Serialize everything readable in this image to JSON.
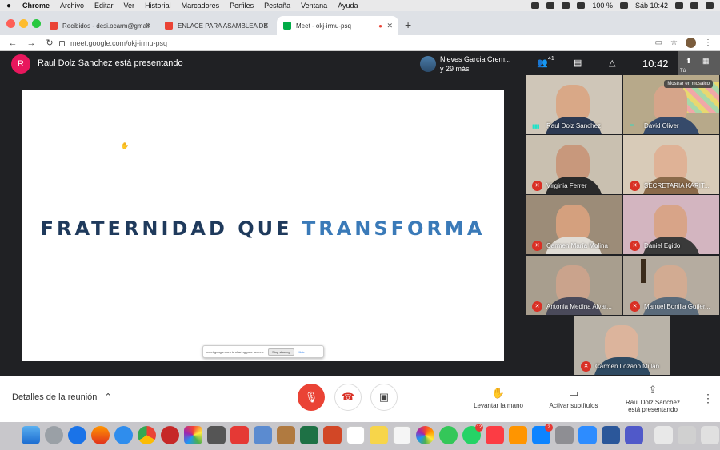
{
  "menubar": {
    "app": "Chrome",
    "items": [
      "Archivo",
      "Editar",
      "Ver",
      "Historial",
      "Marcadores",
      "Perfiles",
      "Pestaña",
      "Ventana",
      "Ayuda"
    ],
    "battery": "100 %",
    "datetime": "Sáb 10:42"
  },
  "tabs": [
    {
      "title": "Recibidos - desi.ocarm@gmail",
      "favicon_color": "#ea4335"
    },
    {
      "title": "ENLACE PARA ASAMBLEA DE",
      "favicon_color": "#ea4335"
    },
    {
      "title": "Meet - okj-irmu-psq",
      "favicon_color": "#00ac47"
    }
  ],
  "address": {
    "url": "meet.google.com/okj-irmu-psq"
  },
  "meet": {
    "presenter_initial": "R",
    "presenting_title": "Raul Dolz Sanchez está presentando",
    "viewer_name": "Nieves Garcia Crem...",
    "viewer_more": "y 29 más",
    "participant_count": "41",
    "clock": "10:42",
    "self_label": "Tú"
  },
  "slide": {
    "title_dark": "FRATERNIDAD QUE ",
    "title_light": "TRANSFORMA",
    "share_bar_text": "meet.google.com is sharing your screen.",
    "stop_sharing": "Stop sharing",
    "hide": "Hide"
  },
  "participants": [
    {
      "name": "Raul Dolz Sanchez",
      "muted": false,
      "bg": "#cfc6b8",
      "skin": "#d9a887",
      "shirt": "#2d3a52"
    },
    {
      "name": "David Oliver",
      "muted": false,
      "bg": "#b7a98a",
      "skin": "#d6a58a",
      "shirt": "#364a6a",
      "mosaic": "Mostrar en mosaico"
    },
    {
      "name": "Virginia Ferrer",
      "muted": true,
      "bg": "#c9c0b0",
      "skin": "#c8987c",
      "shirt": "#2a2a2a"
    },
    {
      "name": "SECRETARIA KARIT...",
      "muted": true,
      "bg": "#d8cbb8",
      "skin": "#dfb296",
      "shirt": "#8a6a4a"
    },
    {
      "name": "Carmen María Molina",
      "muted": true,
      "bg": "#9c8c78",
      "skin": "#d4a07e",
      "shirt": "#e0dcd5"
    },
    {
      "name": "Daniel Egido",
      "muted": true,
      "bg": "#d3b5c0",
      "skin": "#d8a488",
      "shirt": "#3a3a3a"
    },
    {
      "name": "Antonia Medina Alvar...",
      "muted": true,
      "bg": "#a89e8e",
      "skin": "#caa38c",
      "shirt": "#4a4a5a"
    },
    {
      "name": "Manuel Bonilla Gutier...",
      "muted": true,
      "bg": "#b5aca0",
      "skin": "#d2ab92",
      "shirt": "#5a6a7a"
    },
    {
      "name": "Carmen Lozano Millán",
      "muted": true,
      "bg": "#b9b3a8",
      "skin": "#dcb49c",
      "shirt": "#2f4a62"
    }
  ],
  "bottom": {
    "details": "Detalles de la reunión",
    "raise_hand": "Levantar la mano",
    "captions": "Activar subtítulos",
    "presenting_line1": "Raul Dolz Sanchez",
    "presenting_line2": "está presentando"
  }
}
